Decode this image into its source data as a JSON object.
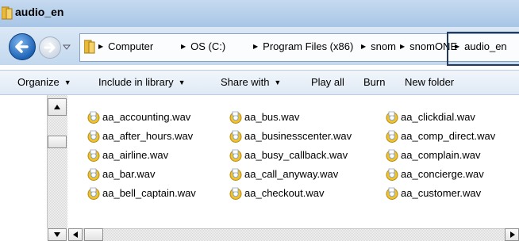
{
  "window": {
    "title": "audio_en"
  },
  "breadcrumb": [
    {
      "label": "Computer"
    },
    {
      "label": "OS (C:)"
    },
    {
      "label": "Program Files (x86)"
    },
    {
      "label": "snom"
    },
    {
      "label": "snomONE"
    },
    {
      "label": "audio_en"
    }
  ],
  "toolbar": {
    "organize": "Organize",
    "include": "Include in library",
    "share": "Share with",
    "play_all": "Play all",
    "burn": "Burn",
    "new_folder": "New folder"
  },
  "files": {
    "col1": [
      "aa_accounting.wav",
      "aa_after_hours.wav",
      "aa_airline.wav",
      "aa_bar.wav",
      "aa_bell_captain.wav"
    ],
    "col2": [
      "aa_bus.wav",
      "aa_businesscenter.wav",
      "aa_busy_callback.wav",
      "aa_call_anyway.wav",
      "aa_checkout.wav"
    ],
    "col3": [
      "aa_clickdial.wav",
      "aa_comp_direct.wav",
      "aa_complain.wav",
      "aa_concierge.wav",
      "aa_customer.wav"
    ]
  },
  "colors": {
    "accent": "#1e63b6",
    "titlebar": "#b7d0ec",
    "highlight_border": "#223a60"
  }
}
